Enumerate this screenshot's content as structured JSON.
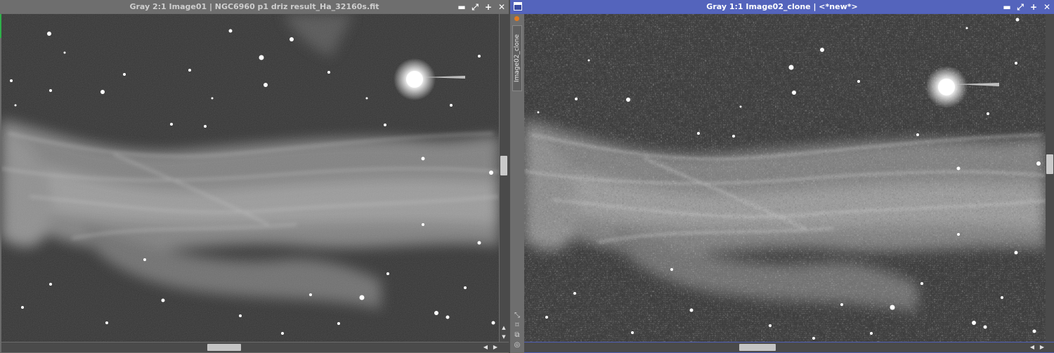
{
  "left_window": {
    "title": "Gray 2:1 Image01 | NGC6960 p1 driz result_Ha_32160s.fit",
    "buttons": {
      "minimize": "▬",
      "shade": "⤢",
      "maximize": "+",
      "close": "✕"
    }
  },
  "right_window": {
    "title": "Gray 1:1 Image02_clone | <*new*>",
    "buttons": {
      "minimize": "▬",
      "shade": "⤢",
      "maximize": "+",
      "close": "✕"
    },
    "side_tab_label": "Image02_clone"
  },
  "colors": {
    "active_titlebar": "#5464bc",
    "inactive_titlebar": "#6e6e6e",
    "preview_marker": "#2fb04a",
    "mask_indicator": "#e07a20"
  },
  "icons": {
    "window_menu": "window-menu-icon",
    "side_tools": [
      "zoom-fit-icon",
      "zoom-extend-icon",
      "copy-icon",
      "target-icon"
    ]
  }
}
